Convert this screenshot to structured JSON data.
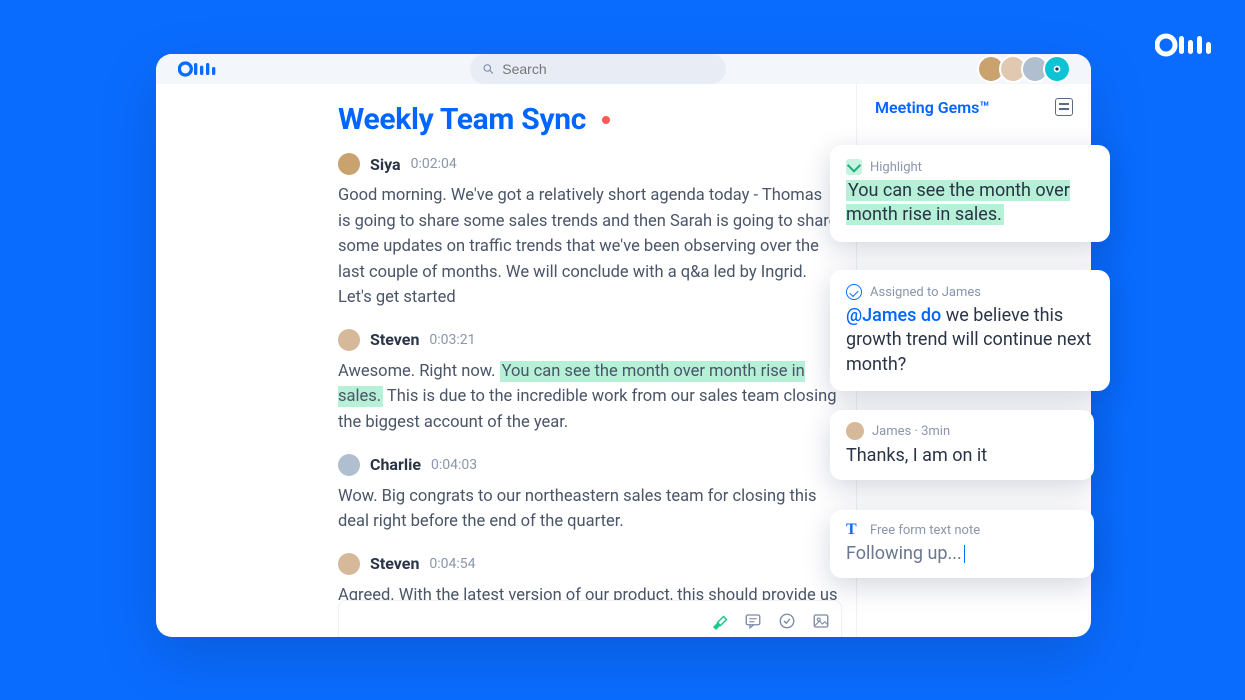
{
  "search": {
    "placeholder": "Search"
  },
  "header": {
    "title": "Weekly Team Sync"
  },
  "rail": {
    "title": "Meeting Gems™"
  },
  "transcript": [
    {
      "speaker": "Siya",
      "time": "0:02:04",
      "text": "Good morning. We've got a relatively short agenda today - Thomas is going to share some sales trends and then Sarah is going to share some updates on traffic trends that we've been observing over the last couple of months. We will conclude with a q&a led by Ingrid. Let's get started"
    },
    {
      "speaker": "Steven",
      "time": "0:03:21",
      "pre": "Awesome. Right now. ",
      "highlight": "You can see the month over month rise in sales.",
      "post": " This is due to the incredible work from our sales team closing the biggest account of the year."
    },
    {
      "speaker": "Charlie",
      "time": "0:04:03",
      "text": "Wow. Big congrats to our northeastern sales team for closing this deal right before the end of the quarter."
    },
    {
      "speaker": "Steven",
      "time": "0:04:54",
      "text": "Agreed. With the latest version of our product, this should provide us more"
    }
  ],
  "gems": {
    "highlight": {
      "label": "Highlight",
      "text": "You can see the month over month rise in sales."
    },
    "action": {
      "label": "Assigned to James",
      "mention": "@James do",
      "rest": " we believe this growth trend will continue next month?"
    },
    "reply": {
      "meta": "James · 3min",
      "text": "Thanks, I am on it"
    },
    "note": {
      "label": "Free form text note",
      "text": "Following up..."
    }
  }
}
